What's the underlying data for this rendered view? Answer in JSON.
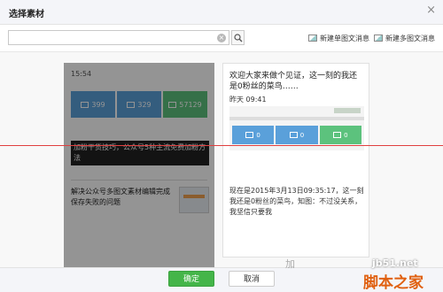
{
  "dialog": {
    "title": "选择素材",
    "close_glyph": "×"
  },
  "toolbar": {
    "search_placeholder": "",
    "clear_glyph": "×",
    "new_single_label": "新建单图文消息",
    "new_multi_label": "新建多图文消息"
  },
  "left_card": {
    "time": "15:54",
    "stats": [
      "399",
      "329",
      "57129"
    ],
    "headline": "加粉干货技巧，公众号5种主流免费加粉方法",
    "sub_title": "解决公众号多图文素材编辑完成保存失败的问题"
  },
  "right_card": {
    "title": "欢迎大家来做个见证，这一刻的我还是0粉丝的菜鸟……",
    "date": "昨天 09:41",
    "stats": [
      "0",
      "0",
      "0"
    ],
    "body": "现在是2015年3月13日09:35:17，这一刻我还是0粉丝的菜鸟，知图：不过没关系，我坚信只要我"
  },
  "footer": {
    "ok_label": "确定",
    "cancel_label": "取消"
  },
  "watermark": {
    "left_text": "加",
    "site": "jb51.net",
    "brand": "脚本之家"
  }
}
